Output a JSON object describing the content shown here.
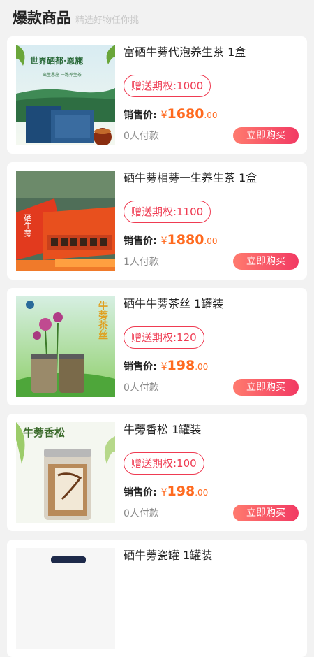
{
  "header": {
    "title": "爆款商品",
    "subtitle": "精选好物任你挑"
  },
  "products": [
    {
      "name": "富硒牛蒡代泡养生茶 1盒",
      "gift": "赠送期权:1000",
      "price_label": "销售价:",
      "currency": "¥",
      "price_int": "1680",
      "price_dec": ".00",
      "paid": "0人付款",
      "buy_label": "立即购买",
      "image_text": "世界硒都·恩施",
      "image_subtext": "出生恩施 一路养生茶"
    },
    {
      "name": "硒牛蒡相蒡一生养生茶 1盒",
      "gift": "赠送期权:1100",
      "price_label": "销售价:",
      "currency": "¥",
      "price_int": "1880",
      "price_dec": ".00",
      "paid": "1人付款",
      "buy_label": "立即购买",
      "image_text": "硒牛蒡"
    },
    {
      "name": "硒牛牛蒡茶丝 1罐装",
      "gift": "赠送期权:120",
      "price_label": "销售价:",
      "currency": "¥",
      "price_int": "198",
      "price_dec": ".00",
      "paid": "0人付款",
      "buy_label": "立即购买",
      "image_text": "牛蒡茶丝"
    },
    {
      "name": "牛蒡香松 1罐装",
      "gift": "赠送期权:100",
      "price_label": "销售价:",
      "currency": "¥",
      "price_int": "198",
      "price_dec": ".00",
      "paid": "0人付款",
      "buy_label": "立即购买",
      "image_text": "牛蒡香松"
    },
    {
      "name": "硒牛蒡瓷罐 1罐装"
    }
  ]
}
